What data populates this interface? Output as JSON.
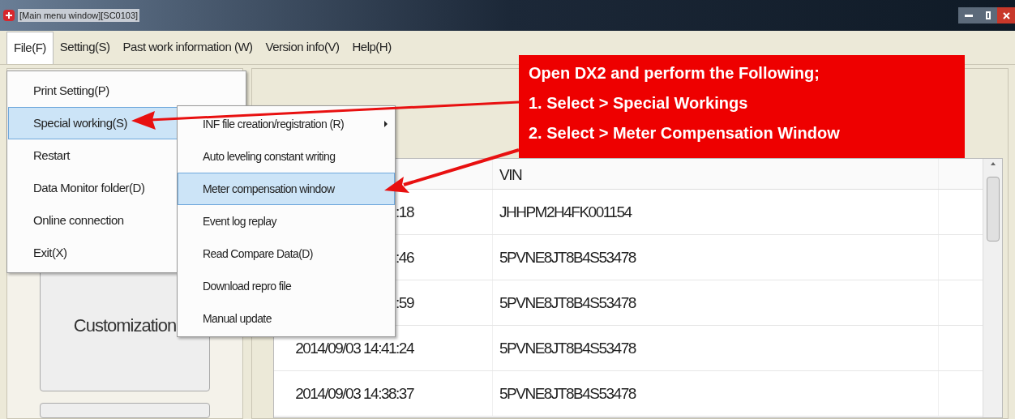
{
  "window": {
    "title": "[Main menu window][SC0103]"
  },
  "menubar": [
    {
      "label": "File(F)",
      "selected": true
    },
    {
      "label": "Setting(S)",
      "selected": false
    },
    {
      "label": "Past work information (W)",
      "selected": false
    },
    {
      "label": "Version info(V)",
      "selected": false
    },
    {
      "label": "Help(H)",
      "selected": false
    }
  ],
  "file_menu": [
    {
      "label": "Print Setting(P)",
      "selected": false
    },
    {
      "label": "Special working(S)",
      "selected": true
    },
    {
      "label": "Restart",
      "selected": false
    },
    {
      "label": "Data Monitor folder(D)",
      "selected": false
    },
    {
      "label": "Online connection",
      "selected": false
    },
    {
      "label": "Exit(X)",
      "selected": false
    }
  ],
  "special_working_menu": [
    {
      "label": "INF file creation/registration (R)",
      "selected": false,
      "submenu": true
    },
    {
      "label": "Auto leveling constant writing",
      "selected": false,
      "submenu": false
    },
    {
      "label": "Meter compensation window",
      "selected": true,
      "submenu": false
    },
    {
      "label": "Event log replay",
      "selected": false,
      "submenu": false
    },
    {
      "label": "Read Compare Data(D)",
      "selected": false,
      "submenu": false
    },
    {
      "label": "Download repro file",
      "selected": false,
      "submenu": false
    },
    {
      "label": "Manual update",
      "selected": false,
      "submenu": false
    }
  ],
  "left_panel": {
    "button": "Customization"
  },
  "table": {
    "column_2": "VIN",
    "rows": [
      {
        "column_1": ":18",
        "vin": "JHHPM2H4FK001154"
      },
      {
        "column_1": ":46",
        "vin": "5PVNE8JT8B4S53478"
      },
      {
        "column_1": ":59",
        "vin": "5PVNE8JT8B4S53478"
      },
      {
        "column_1": "2014/09/03 14:41:24",
        "vin": "5PVNE8JT8B4S53478"
      },
      {
        "column_1": "2014/09/03 14:38:37",
        "vin": "5PVNE8JT8B4S53478"
      }
    ]
  },
  "callout": {
    "lines": [
      "Open DX2 and perform the Following;",
      "1. Select > Special Workings",
      "2. Select > Meter Compensation Window"
    ]
  }
}
